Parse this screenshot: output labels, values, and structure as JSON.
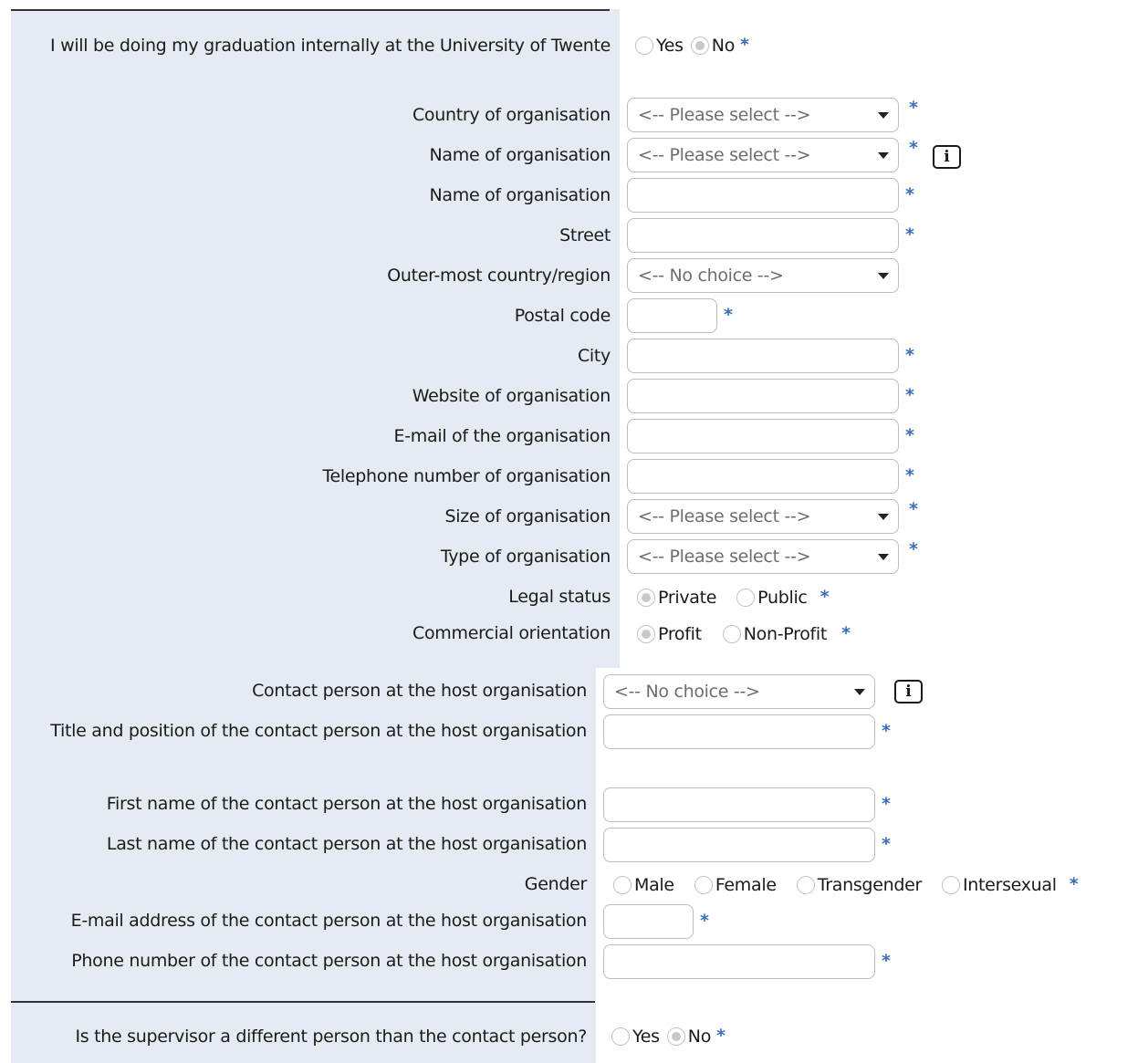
{
  "internal": {
    "label": "I will be doing my graduation internally at the University of Twente",
    "options": [
      "Yes",
      "No"
    ],
    "selected": "No"
  },
  "organisation": {
    "country_label": "Country of organisation",
    "country_value": "<-- Please select -->",
    "name_select_label": "Name of organisation",
    "name_select_value": "<-- Please select -->",
    "name_text_label": "Name of organisation",
    "street_label": "Street",
    "outer_label": "Outer-most country/region",
    "outer_value": "<-- No choice -->",
    "postal_label": "Postal code",
    "city_label": "City",
    "website_label": "Website of organisation",
    "email_label": "E-mail of the organisation",
    "phone_label": "Telephone number of organisation",
    "size_label": "Size of organisation",
    "size_value": "<-- Please select -->",
    "type_label": "Type of organisation",
    "type_value": "<-- Please select -->",
    "legal_label": "Legal status",
    "legal_options": [
      "Private",
      "Public"
    ],
    "legal_selected": "Private",
    "commercial_label": "Commercial orientation",
    "commercial_options": [
      "Profit",
      "Non-Profit"
    ],
    "commercial_selected": "Profit"
  },
  "contact": {
    "person_label": "Contact person at the host organisation",
    "person_value": "<-- No choice -->",
    "title_label": "Title and position of the contact person at the host organisation",
    "first_label": "First name of the contact person at the host organisation",
    "last_label": "Last name of the contact person at the host organisation",
    "gender_label": "Gender",
    "gender_options": [
      "Male",
      "Female",
      "Transgender",
      "Intersexual"
    ],
    "email_label": "E-mail address of the contact person at the host organisation",
    "phone_label": "Phone number of the contact person at the host organisation"
  },
  "supervisor": {
    "label": "Is the supervisor a different person than the contact person?",
    "options": [
      "Yes",
      "No"
    ],
    "selected": "No"
  },
  "required_marker": "*",
  "info_icon_text": "i",
  "colors": {
    "label_bg": "#e6ebf3",
    "required": "#3a6fb7",
    "border": "#bcbcbc"
  }
}
